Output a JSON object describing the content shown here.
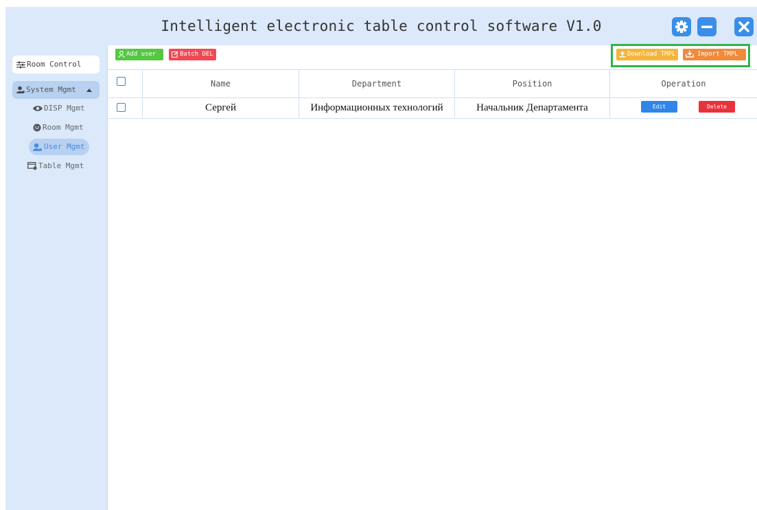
{
  "app": {
    "title": "Intelligent electronic table control software V1.0"
  },
  "window_controls": {
    "settings_icon": "gear-icon",
    "minimize_icon": "minus-icon",
    "close_icon": "close-icon"
  },
  "sidebar": {
    "room_control": "Room Control",
    "system_mgmt": "System Mgmt",
    "items": [
      {
        "label": "DISP Mgmt",
        "icon": "eye-icon",
        "active": false
      },
      {
        "label": "Room Mgmt",
        "icon": "face-icon",
        "active": false
      },
      {
        "label": "User Mgmt",
        "icon": "users-icon",
        "active": true
      },
      {
        "label": "Table Mgmt",
        "icon": "table-icon",
        "active": false
      }
    ]
  },
  "toolbar": {
    "add_user": "Add user",
    "batch_del": "Batch DEL",
    "download_tmpl": "Download TMPL",
    "import_tmpl": "Import TMPL"
  },
  "table": {
    "columns": [
      "Name",
      "Department",
      "Position",
      "Operation"
    ],
    "rows": [
      {
        "name": "Сергей",
        "department": "Информационных технологий",
        "position": "Начальник Департамента",
        "edit": "Edit",
        "delete": "Delete"
      }
    ]
  },
  "colors": {
    "accent": "#3a8ee8",
    "sidebar_bg": "#dbe9fb",
    "add_green": "#55c742",
    "delete_red": "#e8323c",
    "download_orange": "#f5b53a",
    "import_orange": "#f08a3c",
    "highlight_green": "#2eb34a"
  }
}
